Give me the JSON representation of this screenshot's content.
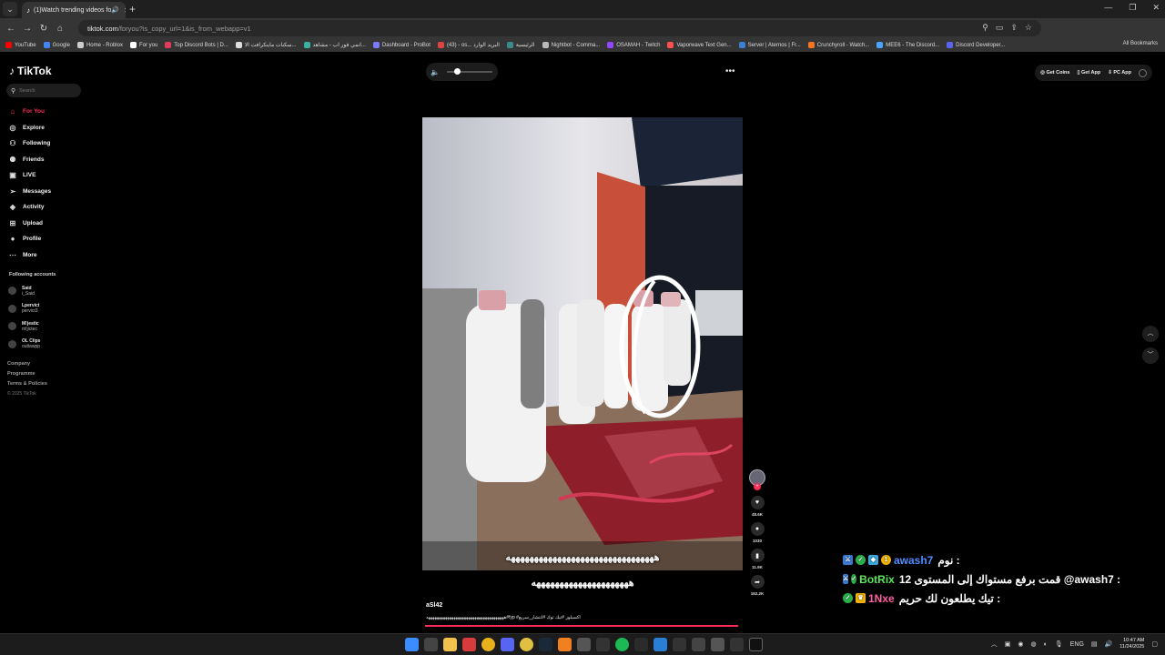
{
  "browser": {
    "tab_title": "(1)Watch trending videos fo",
    "url_host": "tiktok.com",
    "url_path": "/foryou?is_copy_url=1&is_from_webapp=v1",
    "bookmarks": [
      {
        "label": "YouTube",
        "color": "#ff0000"
      },
      {
        "label": "Google",
        "color": "#4285f4"
      },
      {
        "label": "Home - Roblox",
        "color": "#cccccc"
      },
      {
        "label": "For you",
        "color": "#ffffff"
      },
      {
        "label": "Top Discord Bots | D...",
        "color": "#e03c5a"
      },
      {
        "label": "سكنات ماينكرافت الا...",
        "color": "#dddddd"
      },
      {
        "label": "انمي فور اب - مشاهد...",
        "color": "#3ab0a0"
      },
      {
        "label": "Dashboard - ProBot",
        "color": "#7a7aff"
      },
      {
        "label": "(43) - os... البريد الوارد",
        "color": "#d44"
      },
      {
        "label": "الرئيسية",
        "color": "#3a8a8a"
      },
      {
        "label": "Nightbot - Comma...",
        "color": "#bbbbbb"
      },
      {
        "label": "OSAMAH - Twitch",
        "color": "#9146ff"
      },
      {
        "label": "Vaporwave Text Gen...",
        "color": "#ff4f4f"
      },
      {
        "label": "Server | Aternos | Fr...",
        "color": "#3a80d0"
      },
      {
        "label": "Crunchyroll - Watch...",
        "color": "#f47521"
      },
      {
        "label": "MEE6 - The Discord...",
        "color": "#4aa3ff"
      },
      {
        "label": "Discord Developer...",
        "color": "#5865f2"
      }
    ],
    "all_bookmarks": "All Bookmarks"
  },
  "tiktok": {
    "logo": "TikTok",
    "search_placeholder": "Search",
    "nav": [
      {
        "label": "For You",
        "icon": "home-icon",
        "glyph": "⌂"
      },
      {
        "label": "Explore",
        "icon": "compass-icon",
        "glyph": "◎"
      },
      {
        "label": "Following",
        "icon": "following-icon",
        "glyph": "⚇"
      },
      {
        "label": "Friends",
        "icon": "friends-icon",
        "glyph": "⚉"
      },
      {
        "label": "LIVE",
        "icon": "live-icon",
        "glyph": "▣"
      },
      {
        "label": "Messages",
        "icon": "messages-icon",
        "glyph": "➢"
      },
      {
        "label": "Activity",
        "icon": "activity-icon",
        "glyph": "◈"
      },
      {
        "label": "Upload",
        "icon": "upload-icon",
        "glyph": "⊞"
      },
      {
        "label": "Profile",
        "icon": "profile-icon",
        "glyph": "●"
      },
      {
        "label": "More",
        "icon": "more-icon",
        "glyph": "⋯"
      }
    ],
    "following_title": "Following accounts",
    "accounts": [
      {
        "name": "Said",
        "handle": "i_Said"
      },
      {
        "name": "Lpervict",
        "handle": "pervict3"
      },
      {
        "name": "M!jestic",
        "handle": "m!jictec"
      },
      {
        "name": "OL Clips",
        "handle": "outlawpp"
      }
    ],
    "footer": [
      "Company",
      "Programme",
      "Terms & Policies"
    ],
    "copyright": "© 2025 TikTok",
    "top_right": {
      "coins": "Get Coins",
      "app": "Get App",
      "pc": "PC App"
    },
    "video": {
      "caption_overlay": "ههههههههههههههههههههههههههههههههه",
      "caption_below": "هههههههههههههههههههههه",
      "author": "aSl42",
      "description": "هههههههههههههههههههههههههههههههههههههه#fyp #اكسبلور #تيك توك #انتشار_سريع",
      "progress": 0.99
    },
    "actions": {
      "likes": "48.6K",
      "comments": "1030",
      "saves": "11.9K",
      "shares": "162.2K"
    }
  },
  "chat": [
    {
      "user": "awash7",
      "user_color": "#4f8cff",
      "msg": "نوم :"
    },
    {
      "user": "BotRix",
      "user_color": "#5ce65c",
      "msg": "قمت برفع مستواك إلى المستوى 12 @awash7 :"
    },
    {
      "user": "1Nxe",
      "user_color": "#ff5fa2",
      "msg": "تيك يطلعون لك حريم :"
    }
  ],
  "taskbar": {
    "lang": "ENG",
    "time": "10:47 AM",
    "date": "11/24/2025"
  }
}
